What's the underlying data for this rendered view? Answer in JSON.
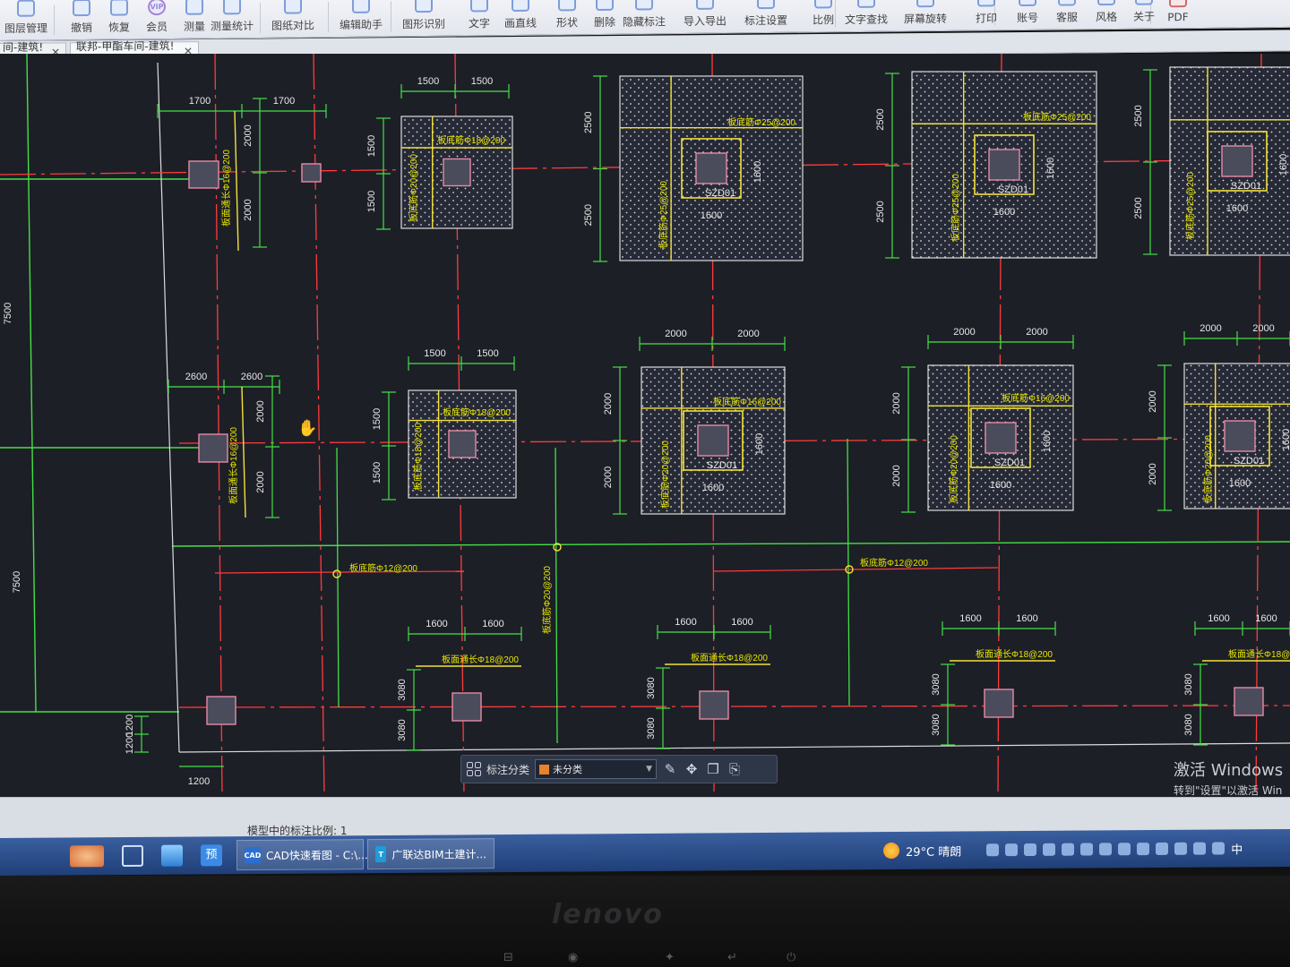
{
  "toolbar": {
    "items": [
      {
        "label": "图层管理",
        "icon": "layers-icon"
      },
      {
        "label": "撤销",
        "icon": "undo-icon"
      },
      {
        "label": "恢复",
        "icon": "redo-icon"
      },
      {
        "label": "会员",
        "icon": "vip-icon"
      },
      {
        "label": "测量",
        "icon": "measure-icon"
      },
      {
        "label": "测量统计",
        "icon": "measure-stats-icon"
      },
      {
        "label": "图纸对比",
        "icon": "compare-icon"
      },
      {
        "label": "编辑助手",
        "icon": "edit-helper-icon"
      },
      {
        "label": "图形识别",
        "icon": "recognize-icon"
      },
      {
        "label": "文字",
        "icon": "text-icon"
      },
      {
        "label": "画直线",
        "icon": "line-icon"
      },
      {
        "label": "形状",
        "icon": "shape-icon"
      },
      {
        "label": "删除",
        "icon": "delete-icon"
      },
      {
        "label": "隐藏标注",
        "icon": "hide-annotation-icon"
      },
      {
        "label": "导入导出",
        "icon": "import-export-icon"
      },
      {
        "label": "标注设置",
        "icon": "annotation-settings-icon"
      },
      {
        "label": "比例",
        "icon": "scale-icon"
      },
      {
        "label": "文字查找",
        "icon": "text-search-icon"
      },
      {
        "label": "屏幕旋转",
        "icon": "rotate-screen-icon"
      },
      {
        "label": "打印",
        "icon": "print-icon"
      },
      {
        "label": "账号",
        "icon": "account-icon"
      },
      {
        "label": "客服",
        "icon": "service-icon"
      },
      {
        "label": "风格",
        "icon": "style-icon"
      },
      {
        "label": "关于",
        "icon": "about-icon"
      },
      {
        "label": "PDF",
        "icon": "pdf-icon"
      }
    ]
  },
  "tabs": [
    {
      "label": "间-建筑!···"
    },
    {
      "label": "联邦-甲酯车间-建筑!···"
    }
  ],
  "drawing": {
    "dims": {
      "d1500": "1500",
      "d2000": "2000",
      "d2500": "2500",
      "d1600": "1600",
      "d1700": "1700",
      "d2600": "2600",
      "d3080": "3080",
      "d1200": "1200",
      "d7500": "7500"
    },
    "marks": {
      "sz01": "SZD01",
      "rebar_18": "板底筋Φ18@200",
      "rebar_25": "板底筋Φ25@200",
      "rebar_16": "板底筋Φ16@200",
      "rebar_12": "板底筋Φ12@200",
      "rebar_20": "板底筋Φ20@200",
      "top_rebar_16": "板面通长Φ16@200",
      "top_rebar_18": "板面通长Φ18@200"
    }
  },
  "annotation_bar": {
    "label": "标注分类",
    "category": "未分类",
    "category_color": "#e7822d",
    "icons": [
      "edit-icon",
      "move-icon",
      "copy-icon",
      "paste-icon"
    ]
  },
  "watermark": {
    "line1": "激活 Windows",
    "line2": "转到\"设置\"以激活 Win"
  },
  "statusbar": {
    "scale_text": "模型中的标注比例: 1"
  },
  "taskbar": {
    "apps": [
      {
        "label": "CAD快速看图 - C:\\..."
      },
      {
        "label": "广联达BIM土建计..."
      }
    ],
    "weather": "29°C 晴朗",
    "ime": "中"
  },
  "bezel": {
    "brand": "lenovo"
  }
}
